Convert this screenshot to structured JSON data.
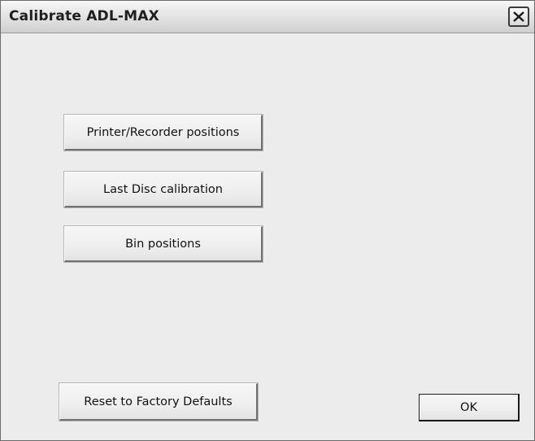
{
  "window": {
    "title": "Calibrate ADL-MAX"
  },
  "icons": {
    "close": "close-icon"
  },
  "buttons": {
    "printer_recorder": "Printer/Recorder positions",
    "last_disc": "Last Disc calibration",
    "bin_positions": "Bin positions",
    "reset_defaults": "Reset to Factory Defaults",
    "ok": "OK"
  }
}
